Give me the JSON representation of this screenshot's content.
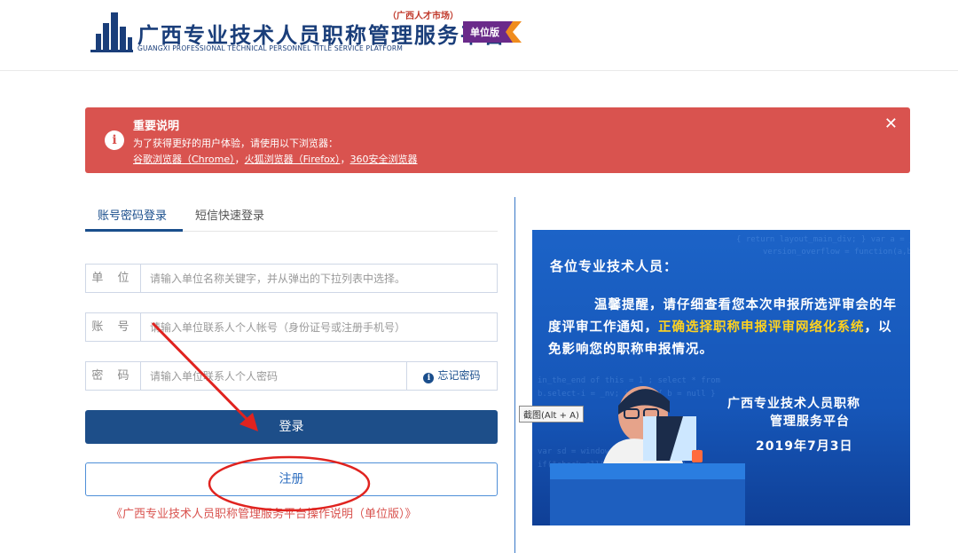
{
  "header": {
    "title": "广西专业技术人员职称管理服务平台",
    "subtitle": "（广西人才市场）",
    "english": "GUANGXI PROFESSIONAL TECHNICAL PERSONNEL TITLE SERVICE PLATFORM",
    "badge": "单位版",
    "brand_color": "#1a3e7a"
  },
  "notice": {
    "title": "重要说明",
    "line": "为了获得更好的用户体验，请使用以下浏览器：",
    "links": [
      "谷歌浏览器（Chrome）",
      "火狐浏览器（Firefox）",
      "360安全浏览器"
    ],
    "separator": "，",
    "close_icon": "close-icon",
    "info_icon": "info-icon",
    "color": "#d9534f"
  },
  "tabs": {
    "password_login": "账号密码登录",
    "sms_login": "短信快速登录"
  },
  "form": {
    "unit_label": "单 位",
    "unit_placeholder": "请输入单位名称关键字，并从弹出的下拉列表中选择。",
    "account_label": "账 号",
    "account_placeholder": "请输入单位联系人个人帐号（身份证号或注册手机号）",
    "password_label": "密 码",
    "password_placeholder": "请输入单位联系人个人密码",
    "forget_password": "忘记密码",
    "login_button": "登录",
    "register_button": "注册",
    "manual_link": "《广西专业技术人员职称管理服务平台操作说明（单位版）》"
  },
  "banner": {
    "greeting": "各位专业技术人员：",
    "body_before": "温馨提醒，请仔细查看您本次申报所选评审会的年度评审工作通知，",
    "body_highlight": "正确选择职称申报评审网络化系统",
    "body_after": "，以免影响您的职称申报情况。",
    "org_line1": "广西专业技术人员职称",
    "org_line2": "管理服务平台",
    "date": "2019年7月3日",
    "highlight_color": "#ffd21f"
  },
  "tooltip": "截图(Alt + A)",
  "accent_color": "#1d4e89"
}
